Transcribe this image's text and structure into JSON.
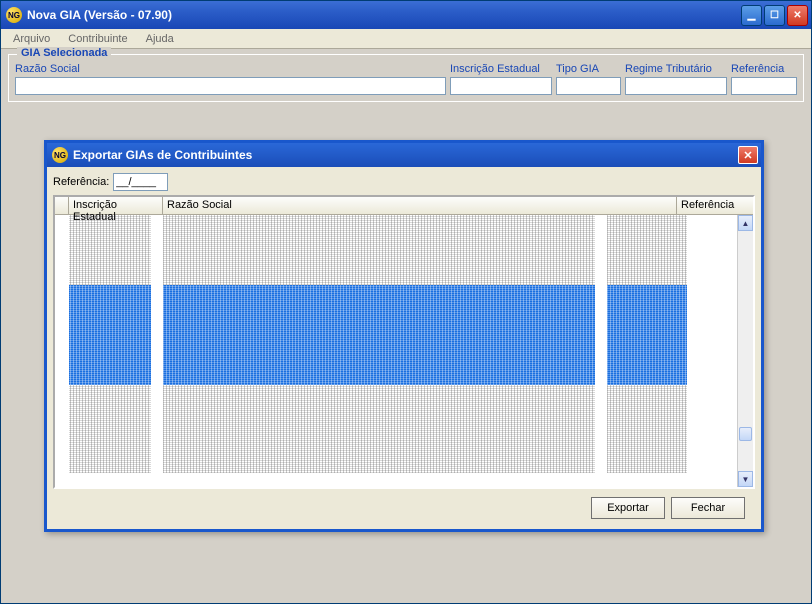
{
  "mainWindow": {
    "title": "Nova GIA (Versão - 07.90)",
    "iconText": "NG"
  },
  "menu": {
    "arquivo": "Arquivo",
    "contribuinte": "Contribuinte",
    "ajuda": "Ajuda"
  },
  "giaSelecionada": {
    "legend": "GIA Selecionada",
    "labels": {
      "razaoSocial": "Razão Social",
      "inscricaoEstadual": "Inscrição Estadual",
      "tipoGia": "Tipo GIA",
      "regimeTributario": "Regime Tributário",
      "referencia": "Referência"
    },
    "values": {
      "razaoSocial": "",
      "inscricaoEstadual": "",
      "tipoGia": "",
      "regimeTributario": "",
      "referencia": ""
    }
  },
  "dialog": {
    "title": "Exportar GIAs de Contribuintes",
    "iconText": "NG",
    "refLabel": "Referência:",
    "refValue": "__/____",
    "columns": {
      "inscricaoEstadual": "Inscrição Estadual",
      "razaoSocial": "Razão Social",
      "referencia": "Referência"
    },
    "buttons": {
      "exportar": "Exportar",
      "fechar": "Fechar"
    }
  }
}
